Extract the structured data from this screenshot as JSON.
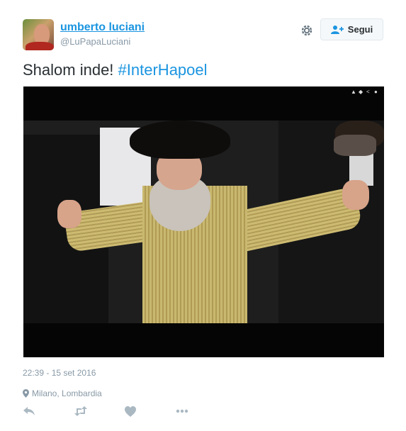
{
  "author": {
    "display_name": "umberto luciani",
    "handle": "@LuPapaLuciani"
  },
  "follow_button": {
    "label": "Segui",
    "icon": "add-user-icon"
  },
  "settings_icon": "gear-icon",
  "tweet": {
    "text": "Shalom inde!",
    "hashtag": "#InterHapoel"
  },
  "media": {
    "type": "video",
    "controls_icons": [
      "like-icon",
      "tag-icon",
      "share-icon",
      "info-icon"
    ]
  },
  "meta": {
    "timestamp": "22:39 - 15 set 2016",
    "location": "Milano, Lombardia",
    "location_icon": "map-pin-icon"
  },
  "actions": [
    "reply-icon",
    "retweet-icon",
    "like-icon",
    "more-icon"
  ],
  "colors": {
    "link": "#1b95e0",
    "muted": "#8899a6",
    "text": "#292f33",
    "button_bg": "#f5f8fa",
    "button_border": "#e1e8ed"
  }
}
